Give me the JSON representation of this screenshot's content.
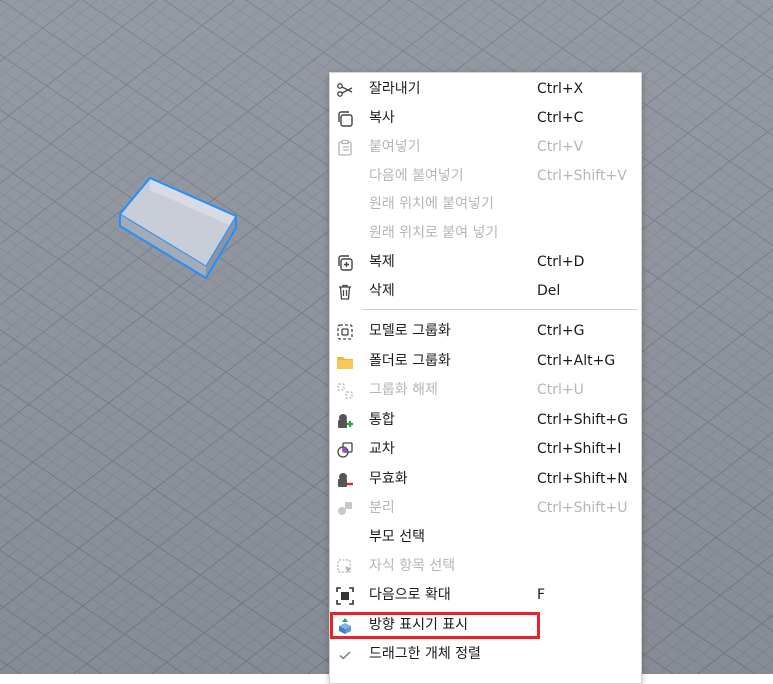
{
  "context_menu": {
    "items": [
      {
        "label": "잘라내기",
        "shortcut": "Ctrl+X",
        "icon": "scissors-icon",
        "enabled": true
      },
      {
        "label": "복사",
        "shortcut": "Ctrl+C",
        "icon": "copy-icon",
        "enabled": true
      },
      {
        "label": "붙여넣기",
        "shortcut": "Ctrl+V",
        "icon": "clipboard-icon",
        "enabled": false
      },
      {
        "label": "다음에 붙여넣기",
        "shortcut": "Ctrl+Shift+V",
        "icon": "",
        "enabled": false
      },
      {
        "label": "원래 위치에 붙여넣기",
        "shortcut": "",
        "icon": "",
        "enabled": false
      },
      {
        "label": "원래 위치로 붙여 넣기",
        "shortcut": "",
        "icon": "",
        "enabled": false
      },
      {
        "label": "복제",
        "shortcut": "Ctrl+D",
        "icon": "duplicate-icon",
        "enabled": true
      },
      {
        "label": "삭제",
        "shortcut": "Del",
        "icon": "trash-icon",
        "enabled": true
      },
      {
        "label": "모델로 그룹화",
        "shortcut": "Ctrl+G",
        "icon": "group-model-icon",
        "enabled": true
      },
      {
        "label": "폴더로 그룹화",
        "shortcut": "Ctrl+Alt+G",
        "icon": "folder-icon",
        "enabled": true
      },
      {
        "label": "그룹화 해제",
        "shortcut": "Ctrl+U",
        "icon": "ungroup-icon",
        "enabled": false
      },
      {
        "label": "통합",
        "shortcut": "Ctrl+Shift+G",
        "icon": "union-icon",
        "enabled": true
      },
      {
        "label": "교차",
        "shortcut": "Ctrl+Shift+I",
        "icon": "intersect-icon",
        "enabled": true
      },
      {
        "label": "무효화",
        "shortcut": "Ctrl+Shift+N",
        "icon": "negate-icon",
        "enabled": true
      },
      {
        "label": "분리",
        "shortcut": "Ctrl+Shift+U",
        "icon": "separate-icon",
        "enabled": false
      },
      {
        "label": "부모 선택",
        "shortcut": "",
        "icon": "",
        "enabled": true
      },
      {
        "label": "자식 항목 선택",
        "shortcut": "",
        "icon": "select-children-icon",
        "enabled": false
      },
      {
        "label": "다음으로 확대",
        "shortcut": "F",
        "icon": "zoom-to-icon",
        "enabled": true
      },
      {
        "label": "방향 표시기 표시",
        "shortcut": "",
        "icon": "orientation-indicator-icon",
        "enabled": true
      },
      {
        "label": "드래그한 개체 정렬",
        "shortcut": "",
        "icon": "checkmark-icon",
        "enabled": true
      }
    ]
  },
  "colors": {
    "ground": "#8d929c",
    "grid_line": "#7f8590",
    "selection": "#1e90ff",
    "highlight_box": "#e8242b",
    "folder": "#f2b63a"
  }
}
